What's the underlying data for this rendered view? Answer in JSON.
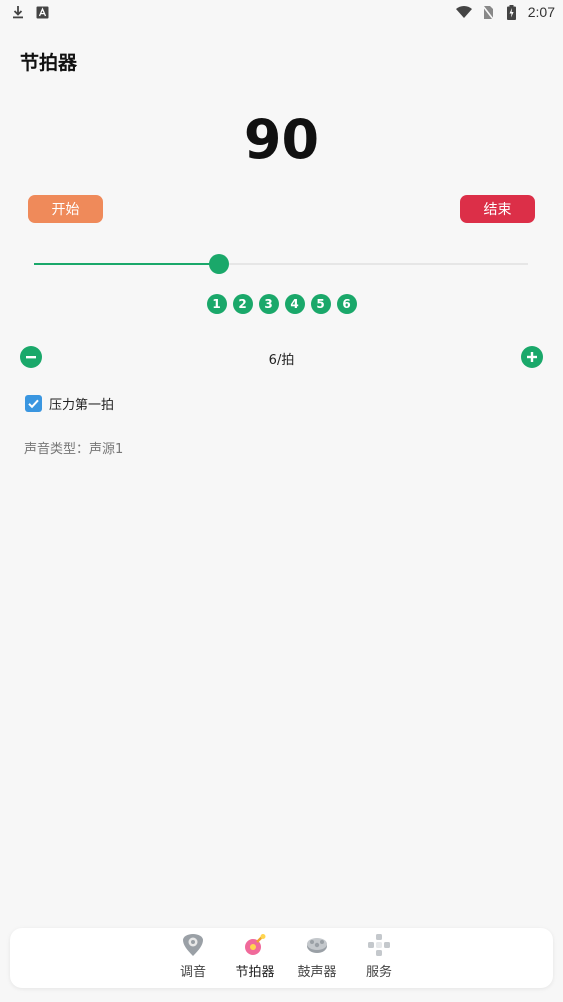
{
  "status_bar": {
    "time": "2:07",
    "left_icons": [
      "download-icon",
      "a-icon"
    ],
    "right_icons": [
      "wifi-icon",
      "no-sim-icon",
      "battery-charging-icon"
    ]
  },
  "page": {
    "title": "节拍器"
  },
  "metronome": {
    "bpm": "90",
    "start_label": "开始",
    "stop_label": "结束",
    "slider_value_fraction": 0.374,
    "beats": [
      "1",
      "2",
      "3",
      "4",
      "5",
      "6"
    ],
    "meter": "6/拍",
    "accent_first_label": "压力第一拍",
    "accent_first_checked": true,
    "sound_type": "声音类型：声源1"
  },
  "bottom_nav": {
    "items": [
      {
        "label": "调音",
        "icon": "guitar-pick-icon"
      },
      {
        "label": "节拍器",
        "icon": "metronome-icon",
        "active": true
      },
      {
        "label": "鼓声器",
        "icon": "drum-icon"
      },
      {
        "label": "服务",
        "icon": "service-grid-icon"
      }
    ]
  },
  "colors": {
    "accent_green": "#1aa86a",
    "start_orange": "#ef8a5a",
    "stop_red": "#dc2f48",
    "checkbox_blue": "#3a96e0"
  }
}
